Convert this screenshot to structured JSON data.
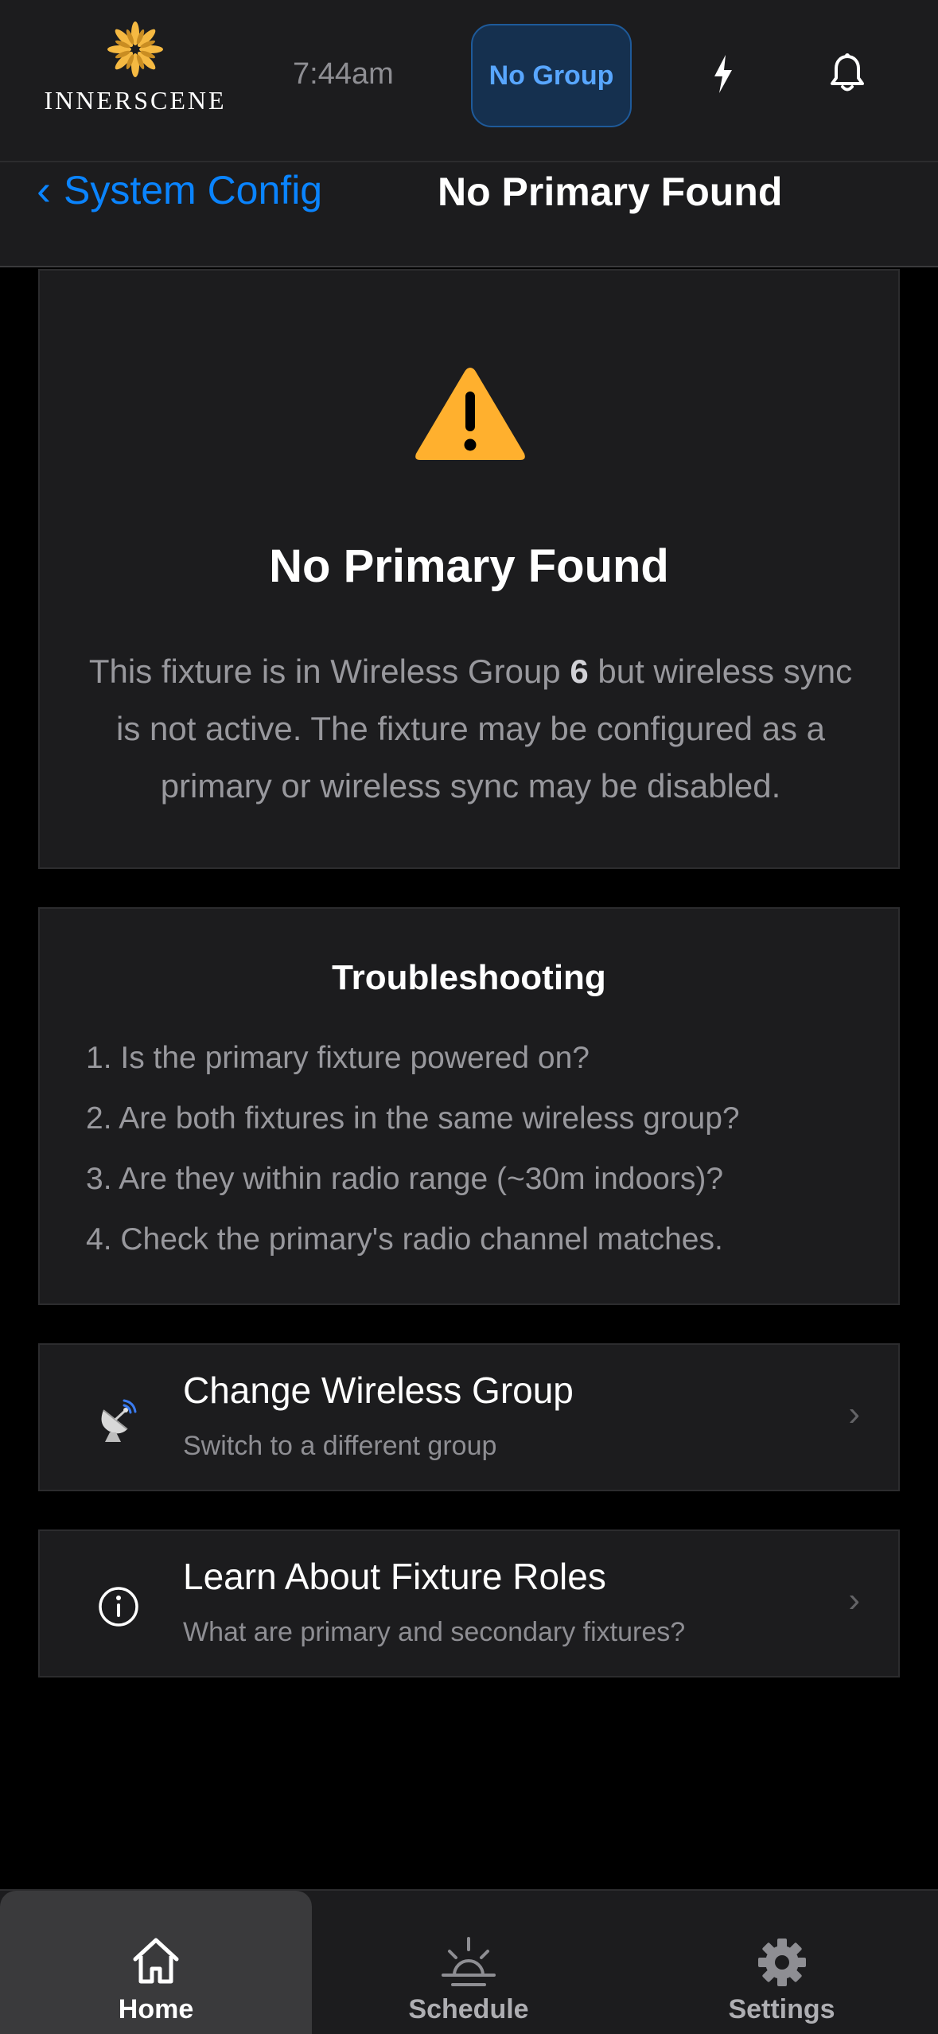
{
  "header": {
    "brand": "INNERSCENE",
    "time": "7:44am",
    "group_button": "No Group",
    "icons": {
      "power": "lightning-bolt-icon",
      "notifications": "bell-icon"
    },
    "colors": {
      "brand_accent": "#f5b942",
      "group_button_text": "#58a6ff"
    }
  },
  "nav": {
    "back_label": "System Config",
    "title": "No Primary Found",
    "colors": {
      "back_link": "#0a84ff"
    }
  },
  "warning": {
    "icon": "warning-triangle-icon",
    "title": "No Primary Found",
    "text_before": "This fixture is in Wireless Group ",
    "group_number": "6",
    "text_after": " but wireless sync is not active. The fixture may be configured as a primary or wireless sync may be disabled.",
    "colors": {
      "icon": "#ffb02e"
    }
  },
  "troubleshooting": {
    "title": "Troubleshooting",
    "items": [
      "1. Is the primary fixture powered on?",
      "2. Are both fixtures in the same wireless group?",
      "3. Are they within radio range (~30m indoors)?",
      "4. Check the primary's radio channel matches."
    ]
  },
  "actions": [
    {
      "icon": "satellite-dish-icon",
      "title": "Change Wireless Group",
      "subtitle": "Switch to a different group",
      "chevron": "›"
    },
    {
      "icon": "info-circle-icon",
      "title": "Learn About Fixture Roles",
      "subtitle": "What are primary and secondary fixtures?",
      "chevron": "›"
    }
  ],
  "tabbar": {
    "tabs": [
      {
        "label": "Home",
        "icon": "home-icon",
        "active": true
      },
      {
        "label": "Schedule",
        "icon": "sunrise-icon",
        "active": false
      },
      {
        "label": "Settings",
        "icon": "gear-icon",
        "active": false
      }
    ]
  }
}
